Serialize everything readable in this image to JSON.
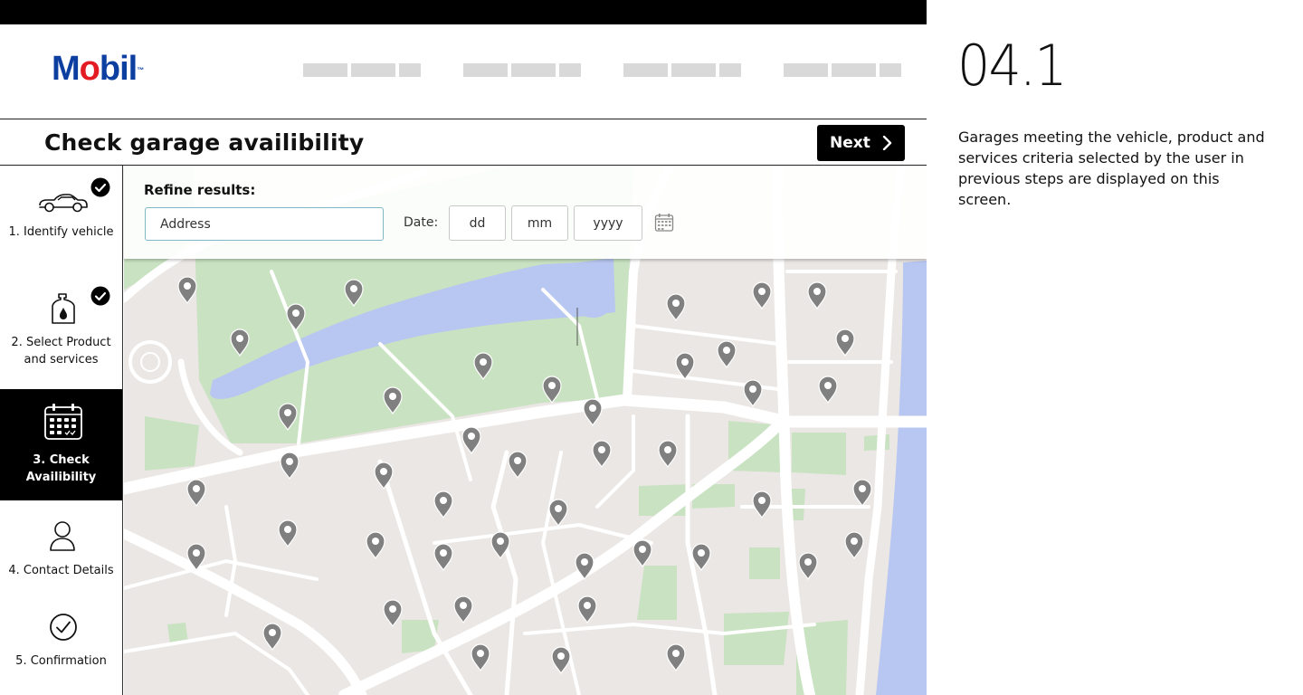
{
  "header": {
    "logo_text": "Mobil",
    "logo_trademark": "™",
    "nav_placeholder_groups": 4
  },
  "page": {
    "title": "Check garage availibility",
    "next_label": "Next"
  },
  "steps": [
    {
      "label": "1. Identify vehicle",
      "icon": "car-icon",
      "state": "complete"
    },
    {
      "label": "2. Select Product and services",
      "icon": "oil-bottle-icon",
      "state": "complete"
    },
    {
      "label": "3. Check Availibility",
      "icon": "calendar-icon",
      "state": "active"
    },
    {
      "label": "4. Contact Details",
      "icon": "person-icon",
      "state": "pending"
    },
    {
      "label": "5. Confirmation",
      "icon": "check-circle-icon",
      "state": "pending"
    }
  ],
  "refine": {
    "title": "Refine results:",
    "address_placeholder": "Address",
    "date_label": "Date:",
    "day_placeholder": "dd",
    "month_placeholder": "mm",
    "year_placeholder": "yyyy",
    "calendar_icon": "calendar-icon"
  },
  "map": {
    "marker_icon": "map-pin-icon",
    "marker_count": 48,
    "colors": {
      "land": "#ebe7e4",
      "park": "#c9e2c2",
      "water": "#b8c6f2",
      "road": "#ffffff",
      "pin": "#808080"
    }
  },
  "side_info": {
    "slide_number": "04.1",
    "description": "Garages meeting the vehicle, product and services criteria selected by the user in previous steps are displayed on this screen."
  },
  "colors": {
    "brand_blue": "#0d3fa0",
    "brand_red": "#e31b23",
    "primary_button": "#000000",
    "active_step": "#000000",
    "input_border": "#7fb8c7"
  }
}
